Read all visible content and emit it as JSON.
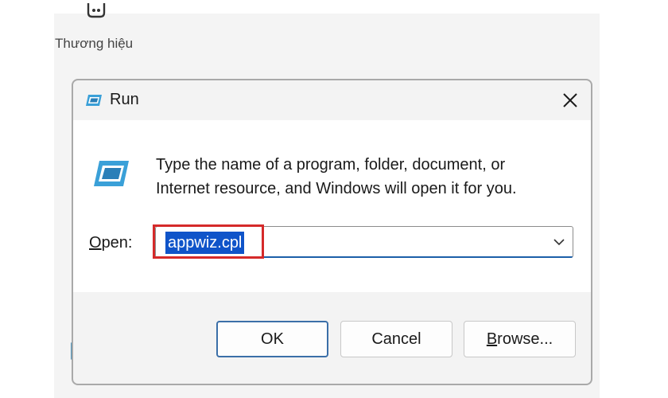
{
  "background": {
    "brand_label": "Thương hiệu"
  },
  "dialog": {
    "title": "Run",
    "close_icon": "close-icon",
    "description_line1": "Type the name of a program, folder, document, or",
    "description_line2": "Internet resource, and Windows will open it for you.",
    "open_label_mnemonic": "O",
    "open_label_rest": "pen:",
    "open_value": "appwiz.cpl",
    "buttons": {
      "ok": "OK",
      "cancel": "Cancel",
      "browse_mnemonic": "B",
      "browse_rest": "rowse..."
    }
  },
  "colors": {
    "selection": "#0f54c9",
    "highlight_box": "#d52a2a",
    "accent_border": "#3b6fa8"
  }
}
